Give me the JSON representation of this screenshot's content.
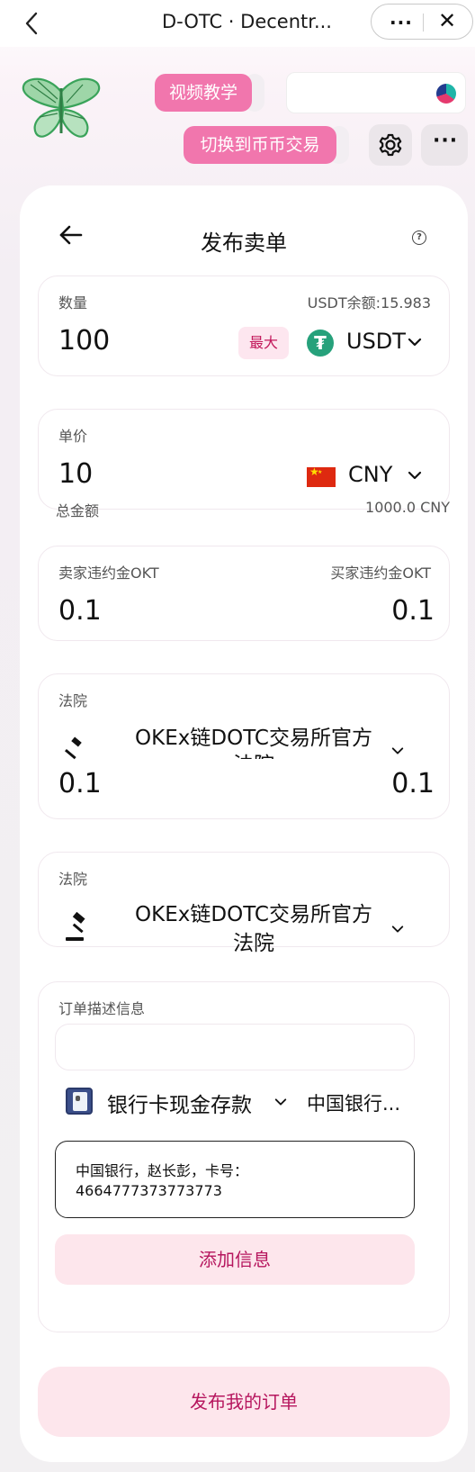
{
  "topbar": {
    "title": "D-OTC · Decentr...",
    "more_label": "···",
    "close_label": "✕"
  },
  "header": {
    "video_tutorial": "视频教学",
    "switch_mode": "切换到币币交易",
    "logo_icon": "butterfly-logo",
    "settings_icon": "gear-icon",
    "more_icon": "more-icon",
    "more_label": "···"
  },
  "page": {
    "title": "发布卖单",
    "help_label": "?"
  },
  "quantity": {
    "label": "数量",
    "balance": "USDT余额:15.983",
    "value": "100",
    "max_label": "最大",
    "token": "USDT"
  },
  "price": {
    "label": "单价",
    "value": "10",
    "currency": "CNY"
  },
  "total": {
    "label": "总金额",
    "value": "1000.0 CNY"
  },
  "deposit": {
    "seller_label": "卖家违约金OKT",
    "buyer_label": "买家违约金OKT",
    "seller_value": "0.1",
    "buyer_value": "0.1"
  },
  "court1": {
    "label": "法院",
    "name": "OKEx链DOTC交易所官方",
    "name_cut": "法院",
    "left_value": "0.1",
    "right_value": "0.1"
  },
  "court2": {
    "label": "法院",
    "name_line1": "OKEx链DOTC交易所官方",
    "name_line2": "法院"
  },
  "order_desc": {
    "label": "订单描述信息",
    "payment_method": "银行卡现金存款",
    "bank": "中国银行...",
    "info_line1": "中国银行，赵长彭，卡号：",
    "info_line2": "4664777373773773",
    "add_button": "添加信息"
  },
  "publish_button": "发布我的订单",
  "colors": {
    "pill_pink": "#f176ad",
    "accent_text": "#b6165e",
    "soft_pink": "#fde6ec",
    "usdt_green": "#26a17b",
    "cny_red": "#de2910"
  }
}
